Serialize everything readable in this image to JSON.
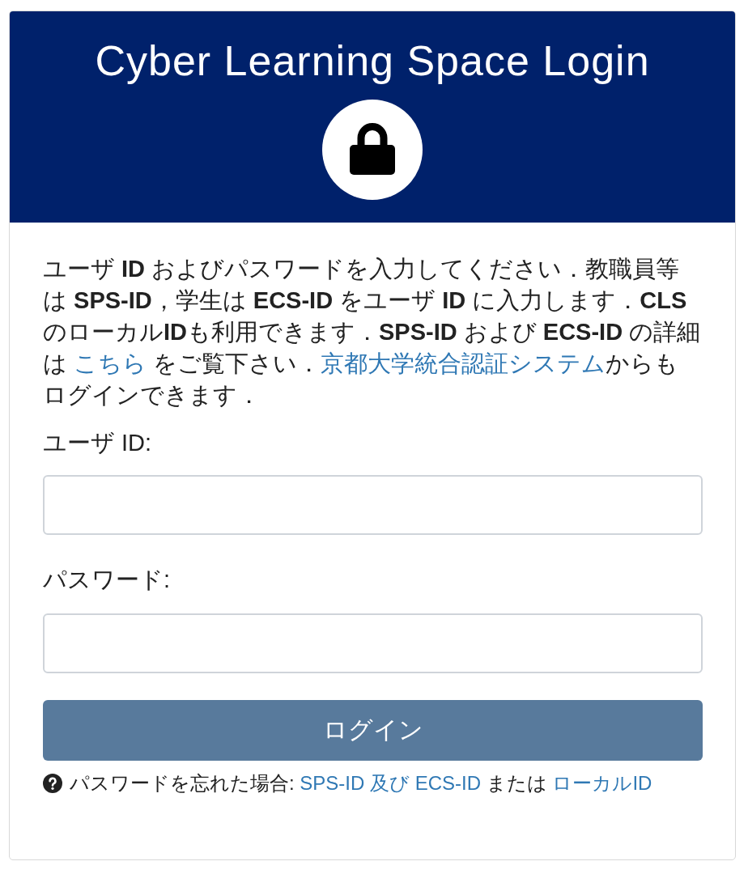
{
  "header": {
    "title": "Cyber Learning Space Login"
  },
  "intro": [
    {
      "kind": "text",
      "text": "ユーザ **ID** およびパスワードを入力してください．教職員等は **SPS-ID**，学生は **ECS-ID** をユーザ **ID** に入力します．**CLS** のローカル**ID**も利用できます．**SPS-ID** および **ECS-ID** の詳細は "
    },
    {
      "kind": "link",
      "text": "こちら"
    },
    {
      "kind": "text",
      "text": " をご覧下さい．"
    },
    {
      "kind": "link",
      "text": "京都大学統合認証システム"
    },
    {
      "kind": "text",
      "text": "からもログインできます．"
    }
  ],
  "fields": [
    {
      "label": "ユーザ ID:"
    },
    {
      "label": "パスワード:"
    }
  ],
  "login_button": {
    "label": "ログイン"
  },
  "help": [
    {
      "kind": "text",
      "text": "パスワードを忘れた場合: "
    },
    {
      "kind": "link",
      "text": "SPS-ID 及び ECS-ID"
    },
    {
      "kind": "text",
      "text": " または "
    },
    {
      "kind": "link",
      "text": "ローカルID"
    }
  ]
}
